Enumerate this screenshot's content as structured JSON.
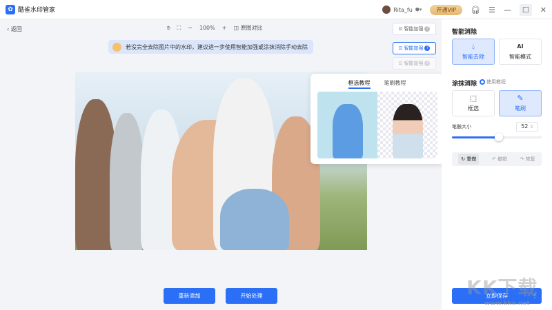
{
  "app": {
    "title": "酷雀水印管家",
    "user": "Rita_fu",
    "vip": "开通VIP"
  },
  "nav": {
    "back": "返回"
  },
  "toolbar": {
    "zoom": "100%",
    "compare": "原图对比",
    "minus": "−",
    "plus": "+"
  },
  "enhance": {
    "label": "智能加强"
  },
  "tip": "若没完全去除图片中的水印，建议进一步使用智能加强或涂抹消除手动去除",
  "tutorial": {
    "tabs": [
      "框选教程",
      "笔刷教程"
    ]
  },
  "actions": {
    "readd": "重新添加",
    "process": "开始处理",
    "save": "立即保存"
  },
  "panel": {
    "smart_title": "智能消除",
    "smart_modes": [
      {
        "label": "智能去除",
        "icon": "drop-icon"
      },
      {
        "label": "智能模式",
        "icon": "ai-icon"
      }
    ],
    "smear_title": "涂抹消除",
    "tutorial_link": "使用教程",
    "tools": [
      {
        "label": "框选",
        "icon": "box-select-icon"
      },
      {
        "label": "笔刷",
        "icon": "brush-icon"
      }
    ],
    "brush_size_label": "笔触大小",
    "brush_size": 52,
    "brush_size_fraction": 0.52,
    "history": [
      "重做",
      "撤销",
      "恢复"
    ]
  },
  "watermark": {
    "text": "KK下载",
    "url": "www.kkx.net"
  }
}
